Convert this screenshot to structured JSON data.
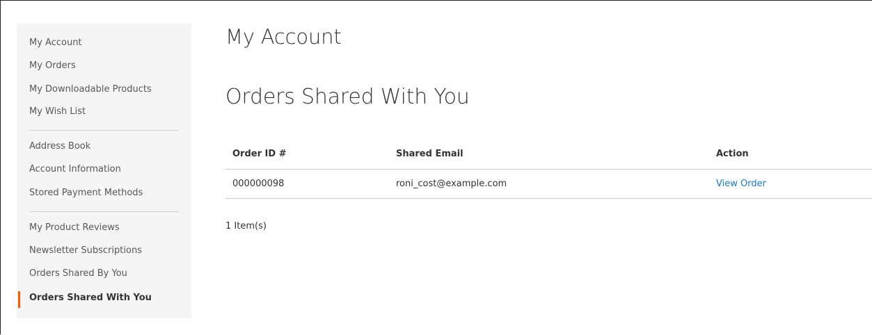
{
  "sidebar": {
    "group1": [
      "My Account",
      "My Orders",
      "My Downloadable Products",
      "My Wish List"
    ],
    "group2": [
      "Address Book",
      "Account Information",
      "Stored Payment Methods"
    ],
    "group3": [
      "My Product Reviews",
      "Newsletter Subscriptions",
      "Orders Shared By You"
    ],
    "active_label": "Orders Shared With You",
    "active_color": "#ff5501"
  },
  "main": {
    "page_title": "My Account",
    "section_title": "Orders Shared With You",
    "table": {
      "headers": [
        "Order ID #",
        "Shared Email",
        "Action"
      ],
      "rows": [
        {
          "order_id": "000000098",
          "shared_email": "roni_cost@example.com",
          "action": "View Order"
        }
      ]
    },
    "item_count": "1 Item(s)",
    "link_color": "#1979c3"
  }
}
